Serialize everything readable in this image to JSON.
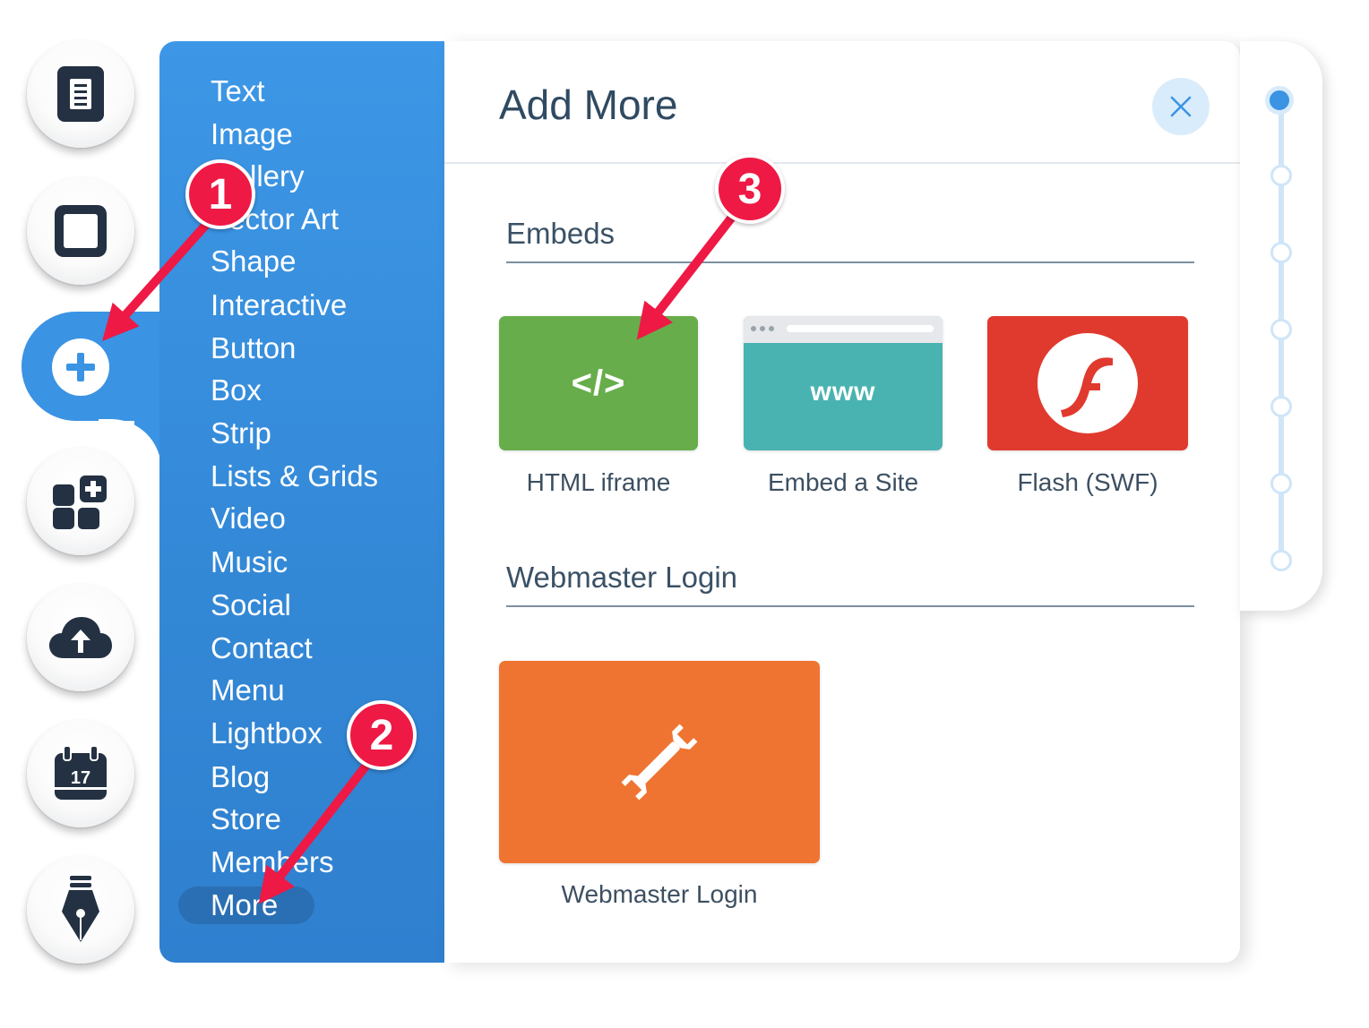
{
  "menu": {
    "items": [
      "Text",
      "Image",
      "Gallery",
      "Vector Art",
      "Shape",
      "Interactive",
      "Button",
      "Box",
      "Strip",
      "Lists & Grids",
      "Video",
      "Music",
      "Social",
      "Contact",
      "Menu",
      "Lightbox",
      "Blog",
      "Store",
      "Members",
      "More"
    ],
    "selected": "More"
  },
  "panel": {
    "title": "Add More",
    "close_icon": "close-icon"
  },
  "sections": [
    {
      "title": "Embeds",
      "tiles": [
        {
          "label": "HTML iframe",
          "icon": "code-icon",
          "color": "#67ad4b",
          "glyph": "</>"
        },
        {
          "label": "Embed a Site",
          "icon": "browser-window-icon",
          "color": "#49b3b1",
          "glyph": "www"
        },
        {
          "label": "Flash (SWF)",
          "icon": "flash-icon",
          "color": "#e03a2e"
        }
      ]
    },
    {
      "title": "Webmaster Login",
      "tiles": [
        {
          "label": "Webmaster Login",
          "icon": "wrench-icon",
          "color": "#ef7432"
        }
      ]
    }
  ],
  "sidebar_tools": [
    "pages-icon",
    "background-icon",
    "add-icon",
    "app-market-icon",
    "upload-icon",
    "calendar-icon",
    "pen-icon"
  ],
  "annotations": {
    "badges": [
      "1",
      "2",
      "3"
    ]
  },
  "colors": {
    "menu_blue": "#3a93e3",
    "badge_red": "#ee1945",
    "title_text": "#2f4a61"
  }
}
